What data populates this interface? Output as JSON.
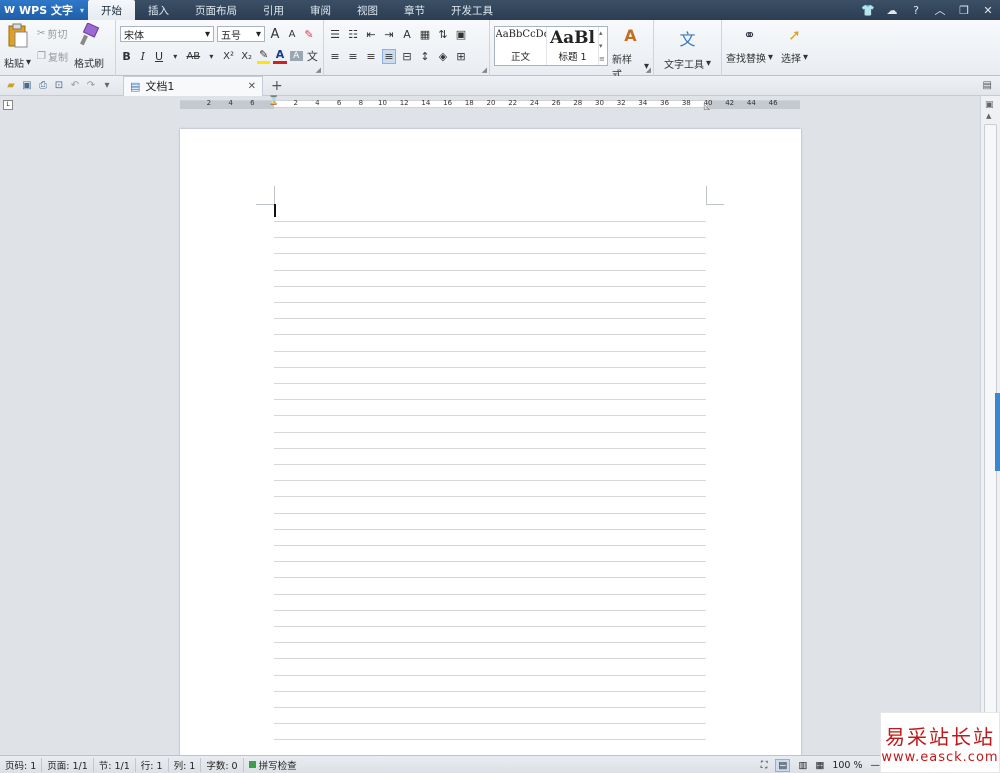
{
  "app": {
    "title": "WPS 文字"
  },
  "menu": {
    "tabs": [
      "开始",
      "插入",
      "页面布局",
      "引用",
      "审阅",
      "视图",
      "章节",
      "开发工具"
    ],
    "active": 0
  },
  "window_controls": {
    "help": "?"
  },
  "ribbon": {
    "clipboard": {
      "paste": "粘贴",
      "cut": "剪切",
      "copy": "复制",
      "format_painter": "格式刷"
    },
    "font": {
      "name": "宋体",
      "size": "五号",
      "bold": "B",
      "italic": "I",
      "underline": "U",
      "strike": "AB",
      "superscript": "X²",
      "subscript": "X₂"
    },
    "styles": {
      "normal_preview": "AaBbCcDd",
      "normal_label": "正文",
      "heading_preview": "AaBl",
      "heading_label": "标题 1",
      "new_style": "新样式"
    },
    "tools": {
      "text_tools": "文字工具",
      "find_replace": "查找替换",
      "select": "选择"
    },
    "colors": {
      "highlight": "#ffe600",
      "font_color": "#d02020",
      "accent": "#2f78c8"
    }
  },
  "quickbar": {
    "doc_tab": "文档1"
  },
  "ruler": {
    "labels_left": [
      "6",
      "4",
      "2"
    ],
    "labels_right": [
      "2",
      "4",
      "6",
      "8",
      "10",
      "12",
      "14",
      "16",
      "18",
      "20",
      "22",
      "24",
      "26",
      "28",
      "30",
      "32",
      "34",
      "36",
      "38",
      "40",
      "42",
      "44",
      "46"
    ]
  },
  "document": {
    "line_count": 34
  },
  "status": {
    "page": "页码: 1",
    "pages": "页面: 1/1",
    "section": "节: 1/1",
    "row": "行: 1",
    "col": "列: 1",
    "words": "字数: 0",
    "spell": "拼写检查",
    "zoom": "100 %"
  },
  "watermark": {
    "line1": "易采站长站",
    "line2": "www.easck.com"
  }
}
